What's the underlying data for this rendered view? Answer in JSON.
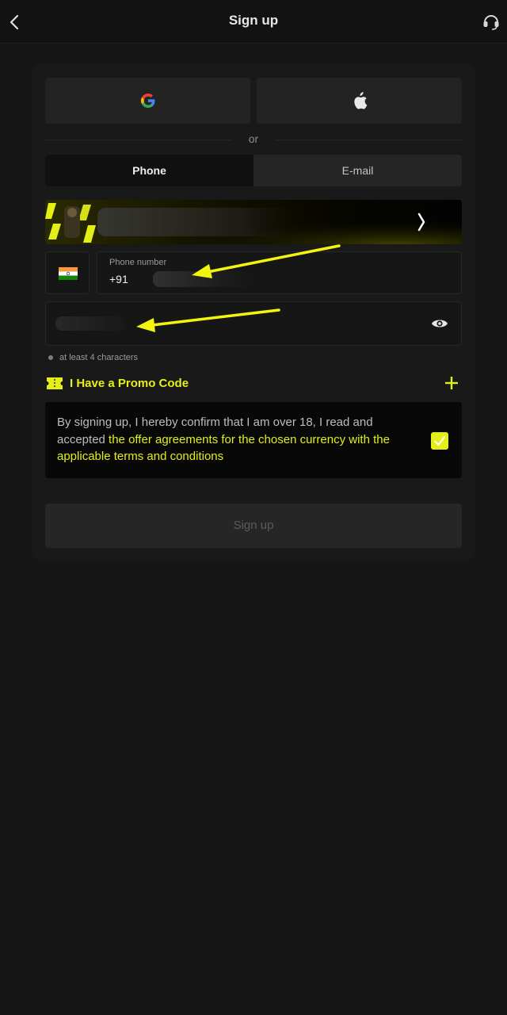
{
  "header": {
    "title": "Sign up",
    "back_icon": "chevron-left-icon",
    "support_icon": "headset-icon"
  },
  "social": {
    "google_icon": "google-icon",
    "apple_icon": "apple-icon"
  },
  "divider": {
    "text": "or"
  },
  "tabs": [
    {
      "label": "Phone",
      "active": true
    },
    {
      "label": "E-mail",
      "active": false
    }
  ],
  "banner": {
    "arrow_icon": "chevron-right-icon"
  },
  "phone": {
    "label": "Phone number",
    "prefix": "+91",
    "country_flag": "india-flag-icon"
  },
  "password": {
    "hint": "at least 4 characters",
    "toggle_icon": "eye-icon"
  },
  "promo": {
    "label": "I Have a Promo Code",
    "icon": "ticket-icon",
    "expand_icon": "plus-icon"
  },
  "consent": {
    "text": "By signing up, I hereby confirm that I am over 18, I read and accepted ",
    "link_text": "the offer agreements for the chosen currency with the applicable terms and conditions",
    "checked": true
  },
  "submit": {
    "label": "Sign up"
  },
  "colors": {
    "accent": "#e4ee17",
    "background": "#161616",
    "surface": "#232323"
  }
}
